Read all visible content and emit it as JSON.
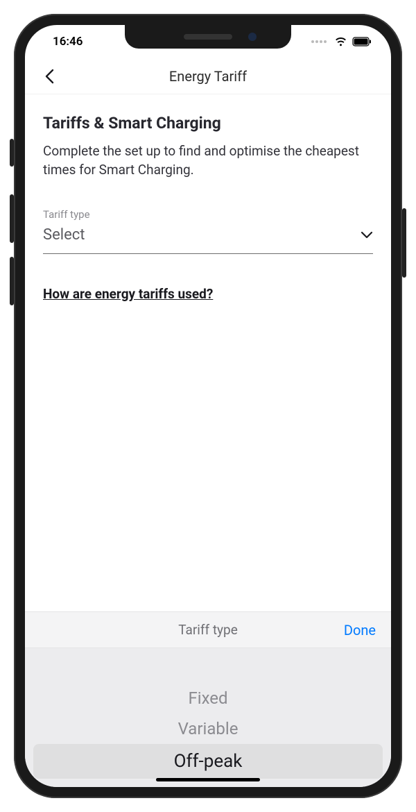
{
  "status": {
    "time": "16:46"
  },
  "nav": {
    "title": "Energy Tariff"
  },
  "section": {
    "heading": "Tariffs & Smart Charging",
    "description": "Complete the set up to find and optimise the cheapest times for Smart Charging."
  },
  "field": {
    "label": "Tariff type",
    "value": "Select"
  },
  "helpLink": {
    "label": "How are energy tariffs used?"
  },
  "picker": {
    "title": "Tariff type",
    "done": "Done",
    "options": {
      "0": "Fixed",
      "1": "Variable",
      "2": "Off-peak"
    }
  }
}
